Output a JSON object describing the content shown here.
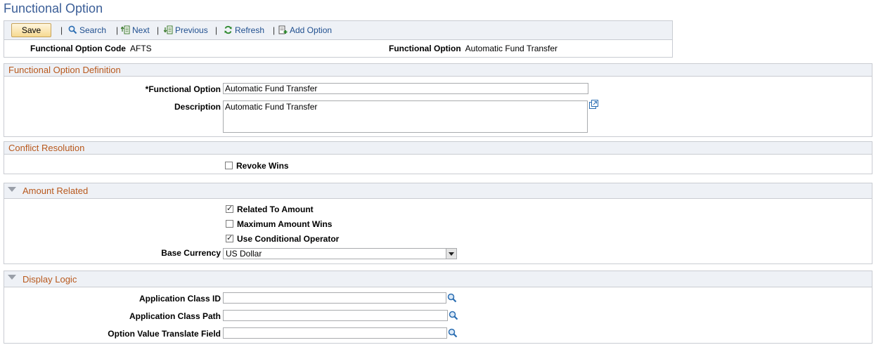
{
  "page": {
    "title": "Functional Option"
  },
  "toolbar": {
    "save_label": "Save",
    "search_label": "Search",
    "next_label": "Next",
    "previous_label": "Previous",
    "refresh_label": "Refresh",
    "add_option_label": "Add Option"
  },
  "header": {
    "code_label": "Functional Option Code",
    "code_value": "AFTS",
    "option_label": "Functional Option",
    "option_value": "Automatic Fund Transfer"
  },
  "definition": {
    "title": "Functional Option Definition",
    "option_label": "*Functional Option",
    "option_value": "Automatic Fund Transfer",
    "description_label": "Description",
    "description_value": "Automatic Fund Transfer"
  },
  "conflict": {
    "title": "Conflict Resolution",
    "revoke_wins_label": "Revoke Wins"
  },
  "amount": {
    "title": "Amount Related",
    "related_label": "Related To Amount",
    "max_wins_label": "Maximum Amount Wins",
    "conditional_label": "Use Conditional Operator",
    "base_currency_label": "Base Currency",
    "base_currency_value": "US Dollar"
  },
  "display_logic": {
    "title": "Display Logic",
    "class_id_label": "Application Class ID",
    "class_path_label": "Application Class Path",
    "translate_label": "Option Value Translate Field"
  },
  "colors": {
    "title": "#3b5e97",
    "section_title": "#b8581c",
    "link": "#1f4f8f"
  }
}
